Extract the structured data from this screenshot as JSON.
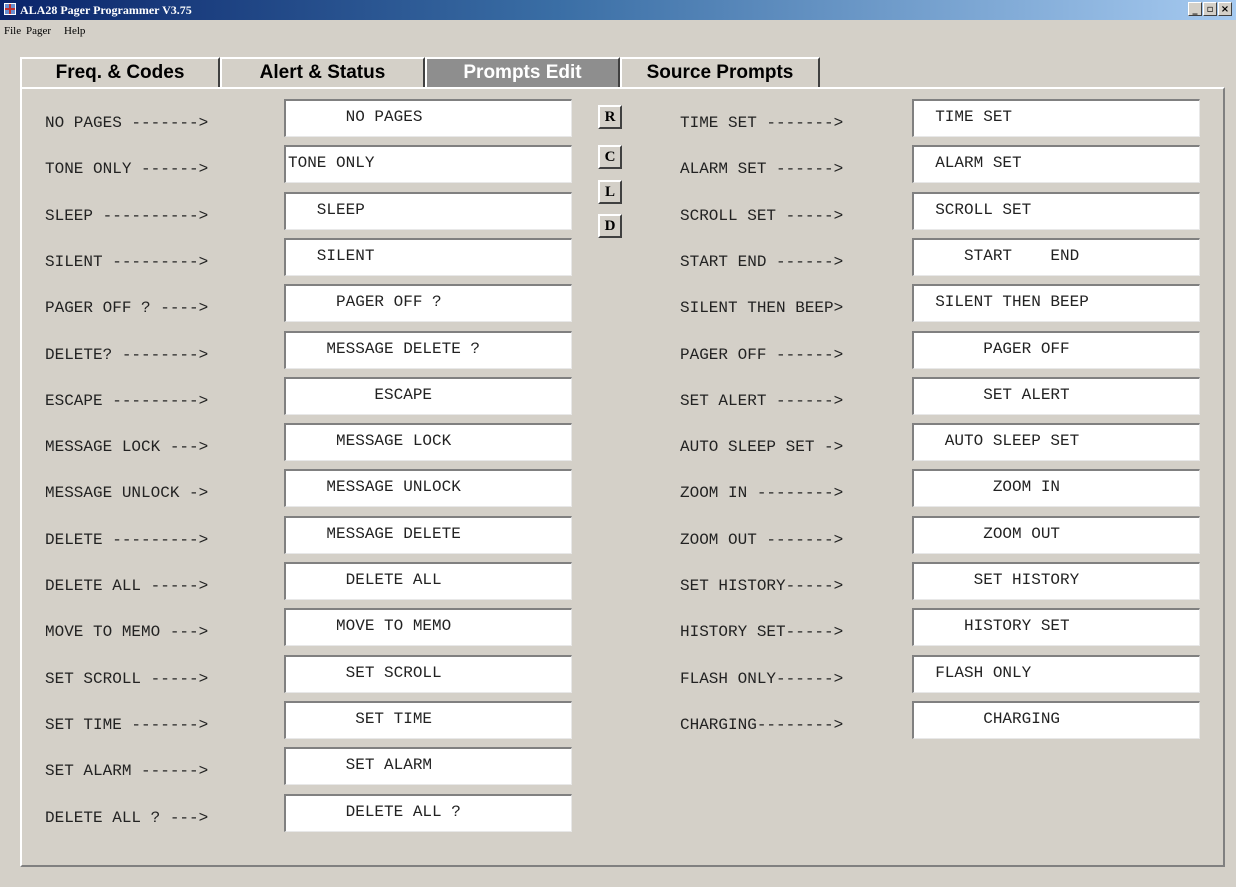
{
  "window": {
    "title": "ALA28 Pager Programmer V3.75",
    "icon": "app-icon",
    "buttons": {
      "minimize": "_",
      "maximize": "▫",
      "close": "×"
    }
  },
  "menu": [
    "File",
    "Pager",
    "Help"
  ],
  "tabs": [
    "Freq. & Codes",
    "Alert & Status",
    "Prompts Edit",
    "Source Prompts"
  ],
  "active_tab": "Prompts Edit",
  "side_buttons": [
    "R",
    "C",
    "L",
    "D"
  ],
  "left_prompts": [
    {
      "label": "NO PAGES ------->",
      "value": "      NO PAGES"
    },
    {
      "label": "TONE ONLY ------>",
      "value": "TONE ONLY"
    },
    {
      "label": "SLEEP ---------->",
      "value": "   SLEEP"
    },
    {
      "label": "SILENT --------->",
      "value": "   SILENT"
    },
    {
      "label": "PAGER OFF ? ---->",
      "value": "     PAGER OFF ?"
    },
    {
      "label": "DELETE? -------->",
      "value": "    MESSAGE DELETE ?"
    },
    {
      "label": "ESCAPE --------->",
      "value": "         ESCAPE"
    },
    {
      "label": "MESSAGE LOCK --->",
      "value": "     MESSAGE LOCK"
    },
    {
      "label": "MESSAGE UNLOCK ->",
      "value": "    MESSAGE UNLOCK"
    },
    {
      "label": "DELETE --------->",
      "value": "    MESSAGE DELETE"
    },
    {
      "label": "DELETE ALL ----->",
      "value": "      DELETE ALL"
    },
    {
      "label": "MOVE TO MEMO --->",
      "value": "     MOVE TO MEMO"
    },
    {
      "label": "SET SCROLL ----->",
      "value": "      SET SCROLL"
    },
    {
      "label": "SET TIME ------->",
      "value": "       SET TIME"
    },
    {
      "label": "SET ALARM ------>",
      "value": "      SET ALARM"
    },
    {
      "label": "DELETE ALL ? --->",
      "value": "      DELETE ALL ?"
    }
  ],
  "right_prompts": [
    {
      "label": "TIME SET ------->",
      "value": "  TIME SET"
    },
    {
      "label": "ALARM SET ------>",
      "value": "  ALARM SET"
    },
    {
      "label": "SCROLL SET ----->",
      "value": "  SCROLL SET"
    },
    {
      "label": "START END ------>",
      "value": "     START    END"
    },
    {
      "label": "SILENT THEN BEEP>",
      "value": "  SILENT THEN BEEP"
    },
    {
      "label": "PAGER OFF ------>",
      "value": "       PAGER OFF"
    },
    {
      "label": "SET ALERT ------>",
      "value": "       SET ALERT"
    },
    {
      "label": "AUTO SLEEP SET ->",
      "value": "   AUTO SLEEP SET"
    },
    {
      "label": "ZOOM IN -------->",
      "value": "        ZOOM IN"
    },
    {
      "label": "ZOOM OUT ------->",
      "value": "       ZOOM OUT"
    },
    {
      "label": "SET HISTORY----->",
      "value": "      SET HISTORY"
    },
    {
      "label": "HISTORY SET----->",
      "value": "     HISTORY SET"
    },
    {
      "label": "FLASH ONLY------>",
      "value": "  FLASH ONLY"
    },
    {
      "label": "CHARGING-------->",
      "value": "       CHARGING"
    }
  ]
}
